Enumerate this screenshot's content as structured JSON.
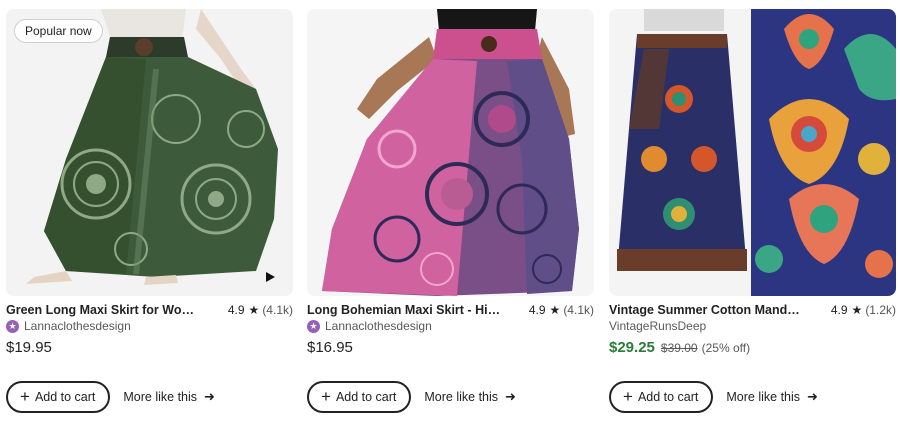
{
  "listings": [
    {
      "badge": "Popular now",
      "title": "Green Long Maxi Skirt for Wome...",
      "rating": "4.9",
      "reviews": "(4.1k)",
      "shop": "Lannaclothesdesign",
      "star_seller": true,
      "price": "$19.95",
      "has_video": true,
      "add_to_cart_label": "Add to cart",
      "more_label": "More like this"
    },
    {
      "title": "Long Bohemian Maxi Skirt - Hipp...",
      "rating": "4.9",
      "reviews": "(4.1k)",
      "shop": "Lannaclothesdesign",
      "star_seller": true,
      "price": "$16.95",
      "add_to_cart_label": "Add to cart",
      "more_label": "More like this"
    },
    {
      "title": "Vintage Summer Cotton Mandal...",
      "rating": "4.9",
      "reviews": "(1.2k)",
      "shop": "VintageRunsDeep",
      "star_seller": false,
      "price": "$29.25",
      "original_price": "$39.00",
      "discount": "(25% off)",
      "add_to_cart_label": "Add to cart",
      "more_label": "More like this"
    }
  ],
  "colors": {
    "sale_price": "#2a7d39",
    "star_seller_badge": "#9560b8",
    "text": "#222222"
  }
}
